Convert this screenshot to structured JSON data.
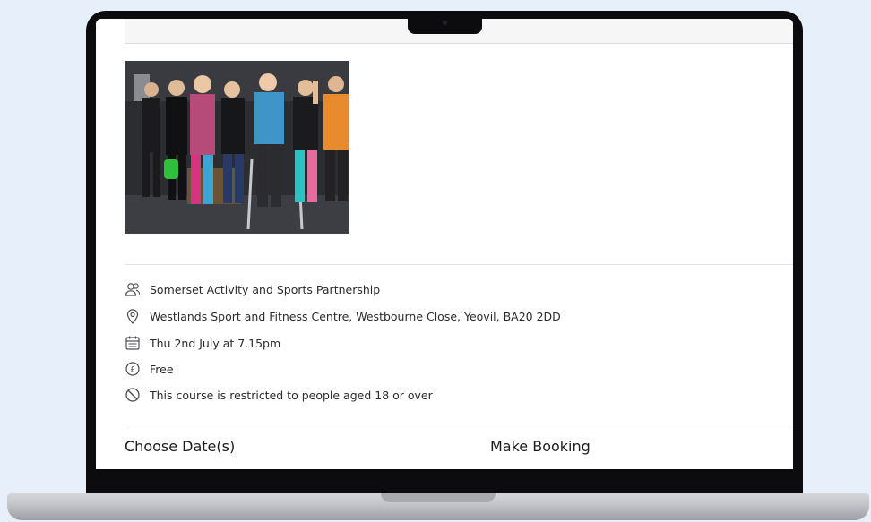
{
  "details": {
    "organiser": "Somerset Activity and Sports Partnership",
    "venue": "Westlands Sport and Fitness Centre, Westbourne Close, Yeovil, BA20 2DD",
    "date": "Thu 2nd July at 7.15pm",
    "price": "Free",
    "restriction": "This course is restricted to people aged 18 or over"
  },
  "sections": {
    "choose_dates": "Choose Date(s)",
    "make_booking": "Make Booking"
  },
  "icons": {
    "organiser": "people-icon",
    "venue": "location-pin-icon",
    "date": "calendar-icon",
    "price": "pound-coin-icon",
    "restriction": "prohibited-icon"
  },
  "colors": {
    "background": "#e6effa",
    "laptop_bezel": "#0c0c0e",
    "text": "#2a2a2f"
  }
}
